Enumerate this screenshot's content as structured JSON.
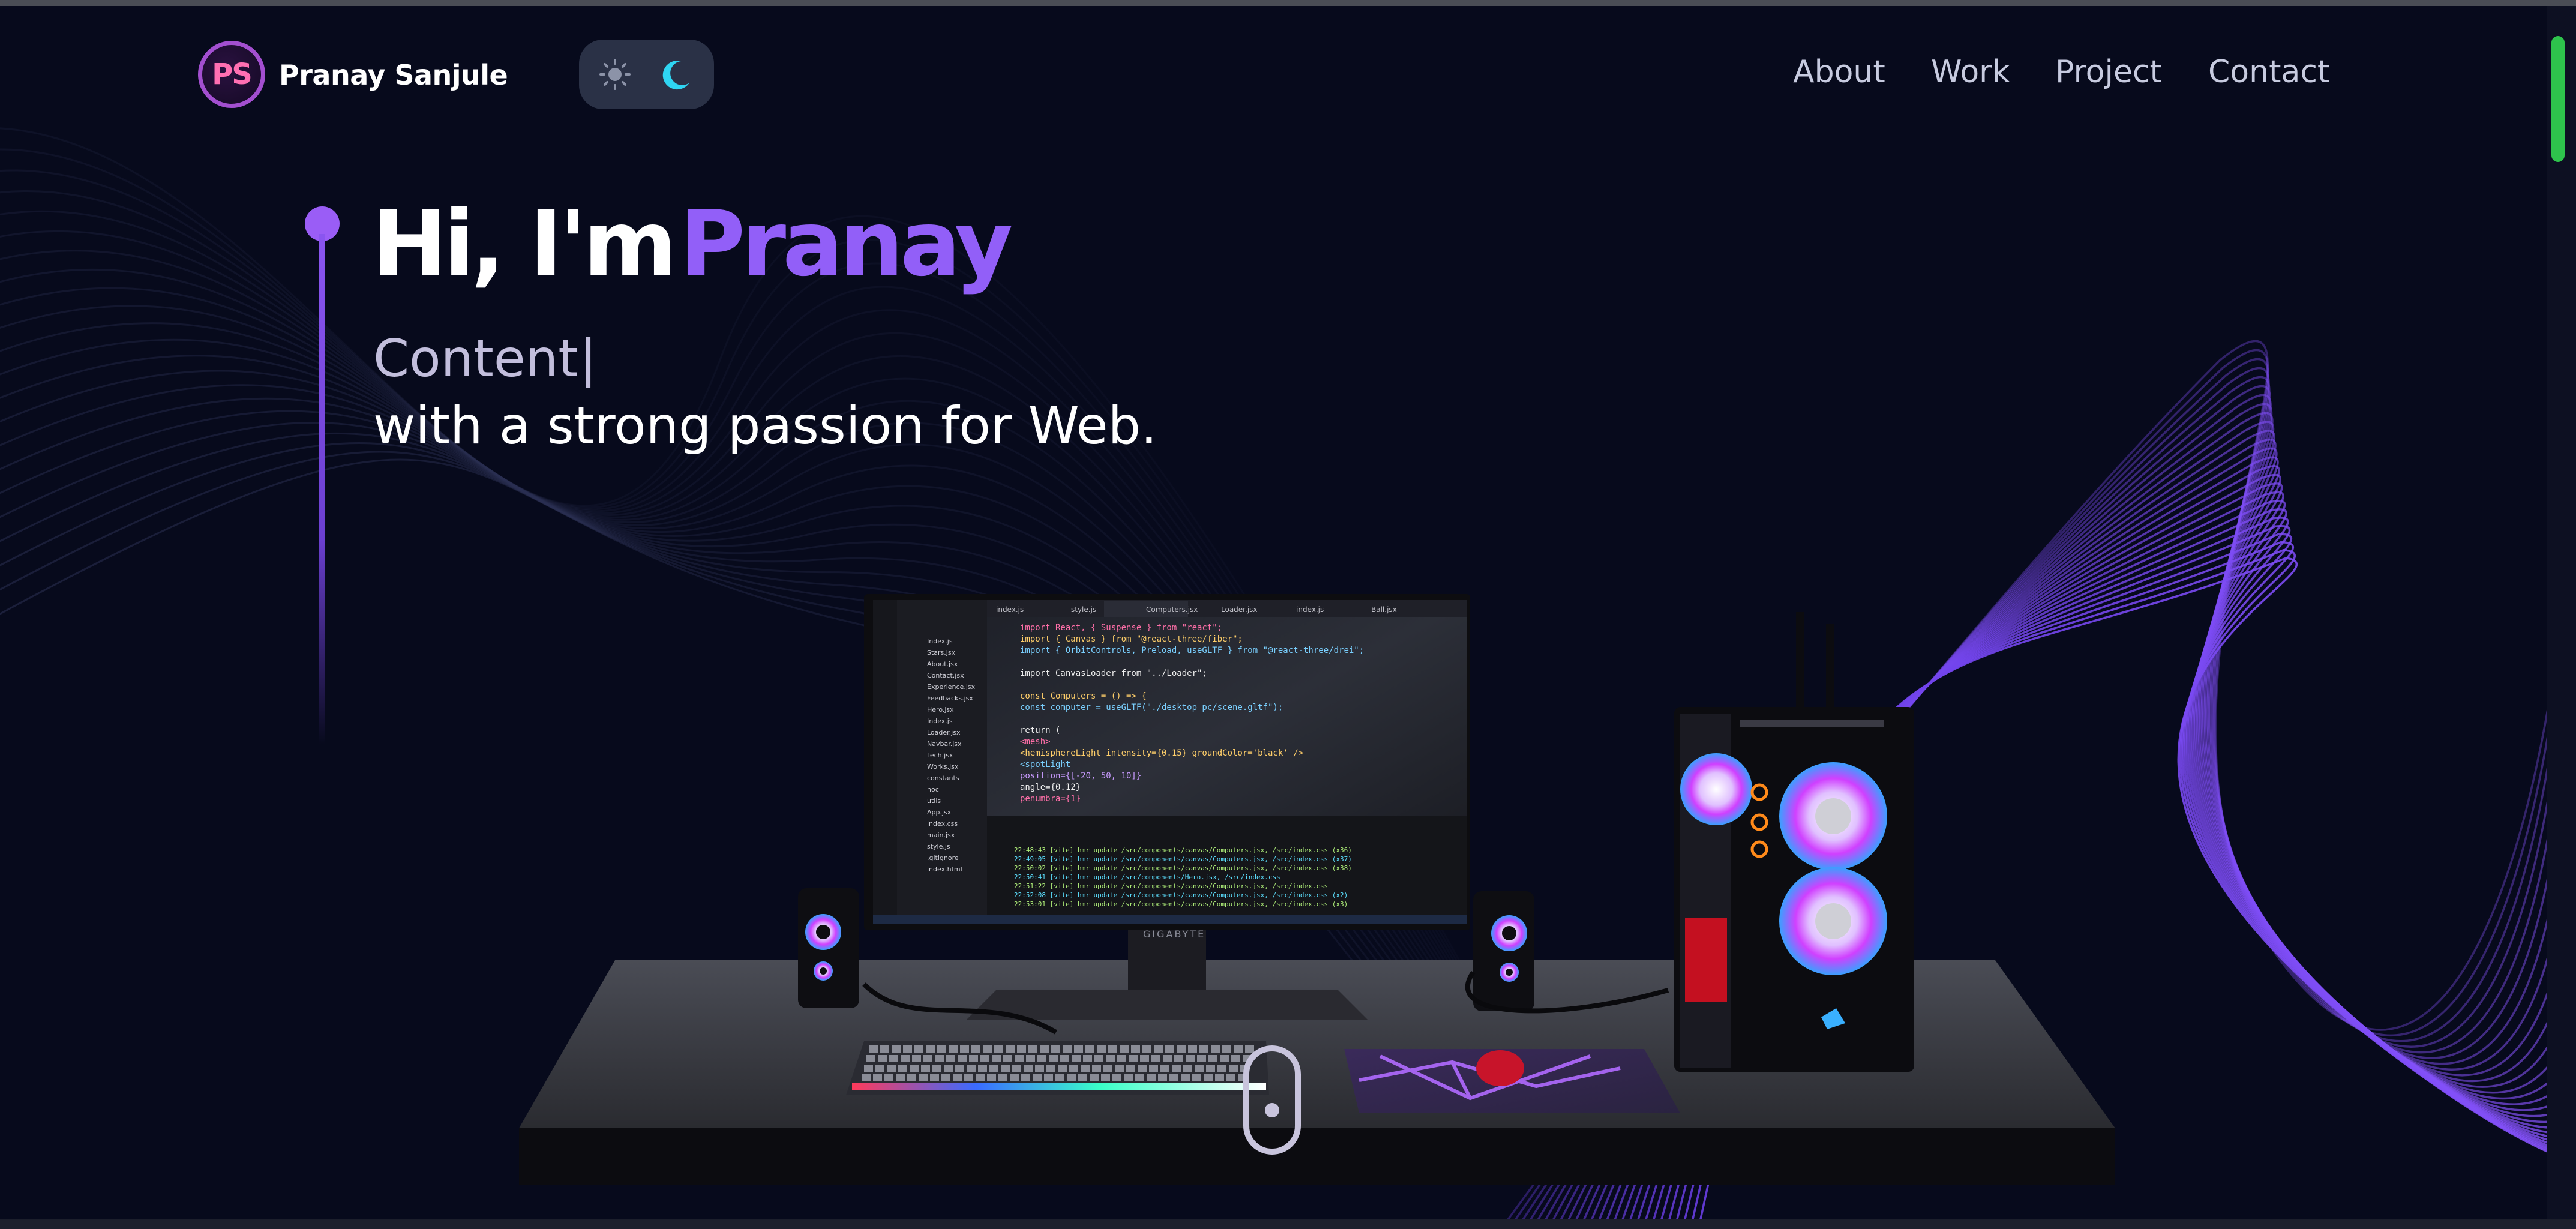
{
  "header": {
    "logo_text": "PS",
    "brand_name": "Pranay Sanjule",
    "theme_toggle": {
      "icons": [
        "sun-icon",
        "moon-icon"
      ],
      "active": "moon"
    },
    "nav": [
      {
        "label": "About"
      },
      {
        "label": "Work"
      },
      {
        "label": "Project"
      },
      {
        "label": "Contact"
      }
    ]
  },
  "hero": {
    "greeting": "Hi, I'm",
    "name": "Pranay",
    "typed_text": "Content",
    "caret": "|",
    "tagline": "with a strong passion for Web."
  },
  "monitor": {
    "brand": "GIGABYTE",
    "editor": {
      "tabs": [
        "index.js",
        "style.js",
        "Computers.jsx",
        "Loader.jsx",
        "index.js",
        "Ball.jsx"
      ],
      "code_lines": [
        "import React, { Suspense } from \"react\";",
        "import { Canvas } from \"@react-three/fiber\";",
        "import { OrbitControls, Preload, useGLTF } from \"@react-three/drei\";",
        "",
        "import CanvasLoader from \"../Loader\";",
        "",
        "const Computers = () => {",
        "  const computer = useGLTF(\"./desktop_pc/scene.gltf\");",
        "",
        "  return (",
        "    <mesh>",
        "      <hemisphereLight intensity={0.15} groundColor='black' />",
        "      <spotLight",
        "        position={[-20, 50, 10]}",
        "        angle={0.12}",
        "        penumbra={1}"
      ],
      "files": [
        "Index.js",
        "Stars.jsx",
        "About.jsx",
        "Contact.jsx",
        "Experience.jsx",
        "Feedbacks.jsx",
        "Hero.jsx",
        "Index.js",
        "Loader.jsx",
        "Navbar.jsx",
        "Tech.jsx",
        "Works.jsx",
        "constants",
        "hoc",
        "utils",
        "App.jsx",
        "index.css",
        "main.jsx",
        "style.js",
        ".gitignore",
        "index.html"
      ],
      "terminal_lines": [
        "22:48:43 [vite] hmr update /src/components/canvas/Computers.jsx, /src/index.css (x36)",
        "22:49:05 [vite] hmr update /src/components/canvas/Computers.jsx, /src/index.css (x37)",
        "22:50:02 [vite] hmr update /src/components/canvas/Computers.jsx, /src/index.css (x38)",
        "22:50:41 [vite] hmr update /src/components/Hero.jsx, /src/index.css",
        "22:51:22 [vite] hmr update /src/components/canvas/Computers.jsx, /src/index.css",
        "22:52:08 [vite] hmr update /src/components/canvas/Computers.jsx, /src/index.css (x2)",
        "22:53:01 [vite] hmr update /src/components/canvas/Computers.jsx, /src/index.css (x3)"
      ]
    }
  },
  "colors": {
    "background": "#070a1c",
    "accent_purple": "#925ff8",
    "nav_text": "#c7cbe0",
    "scrollbar": "#2ec34c"
  }
}
